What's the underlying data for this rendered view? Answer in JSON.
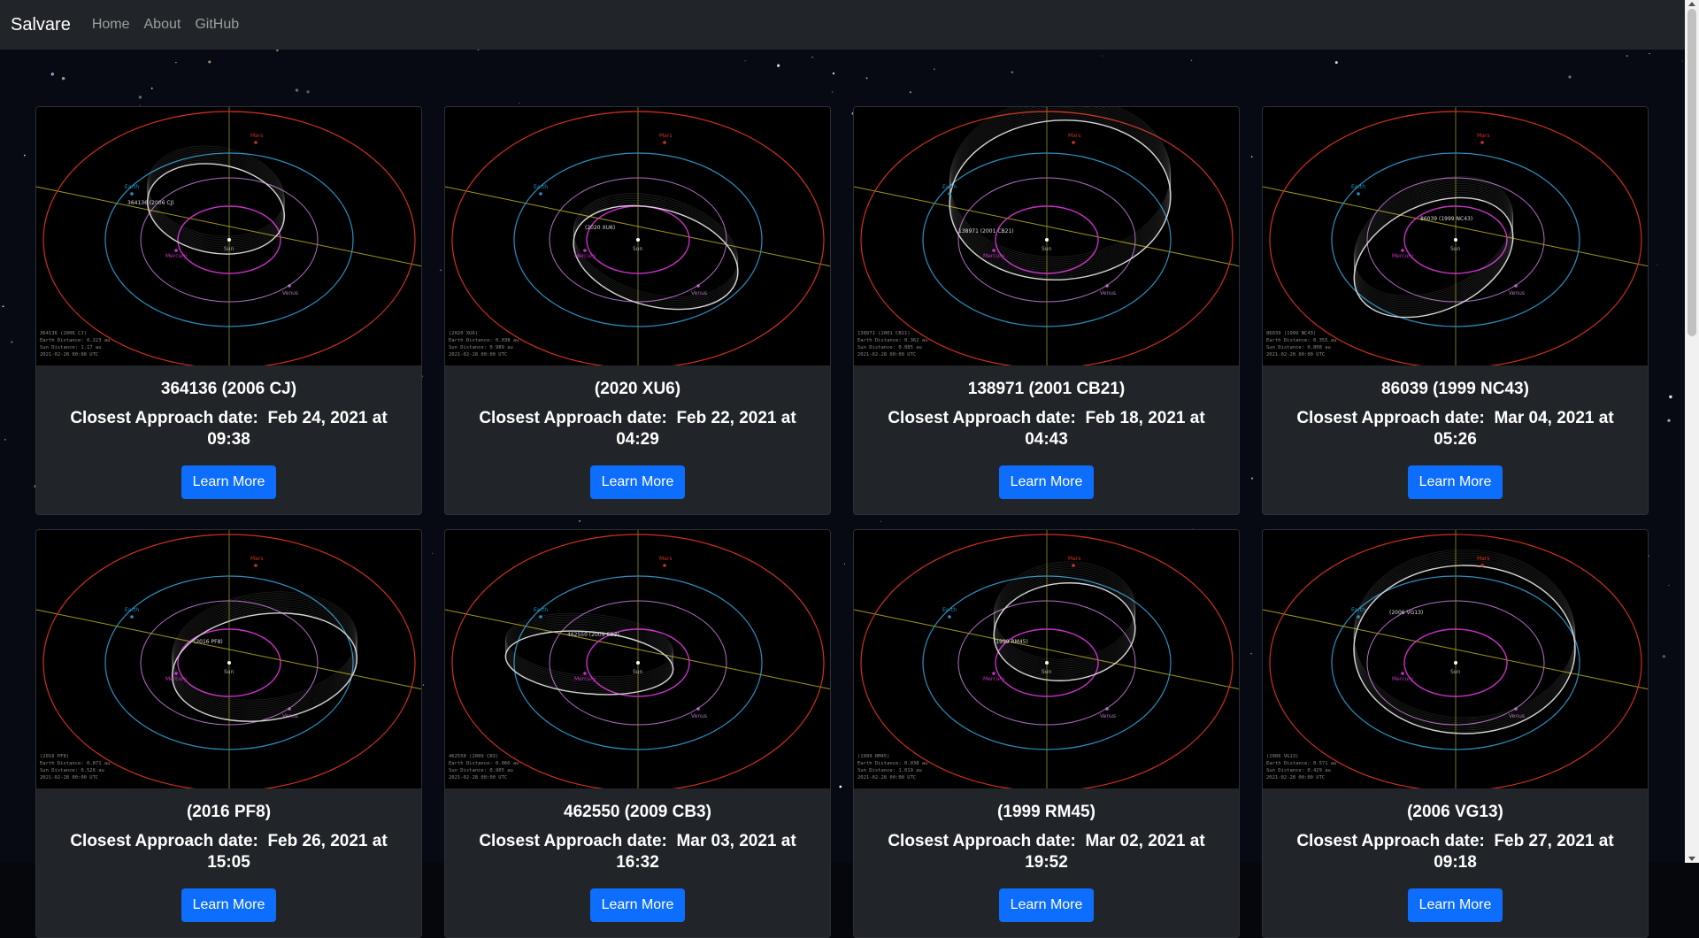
{
  "nav": {
    "brand": "Salvare",
    "links": [
      "Home",
      "About",
      "GitHub"
    ]
  },
  "cards": [
    {
      "name": "364136 (2006 CJ)",
      "approach_label": "Closest Approach date:",
      "approach": "Feb 24, 2021 at 09:38",
      "button": "Learn More"
    },
    {
      "name": "(2020 XU6)",
      "approach_label": "Closest Approach date:",
      "approach": "Feb 22, 2021 at 04:29",
      "button": "Learn More"
    },
    {
      "name": "138971 (2001 CB21)",
      "approach_label": "Closest Approach date:",
      "approach": "Feb 18, 2021 at 04:43",
      "button": "Learn More"
    },
    {
      "name": "86039 (1999 NC43)",
      "approach_label": "Closest Approach date:",
      "approach": "Mar 04, 2021 at 05:26",
      "button": "Learn More"
    },
    {
      "name": "(2016 PF8)",
      "approach_label": "Closest Approach date:",
      "approach": "Feb 26, 2021 at 15:05",
      "button": "Learn More"
    },
    {
      "name": "462550 (2009 CB3)",
      "approach_label": "Closest Approach date:",
      "approach": "Mar 03, 2021 at 16:32",
      "button": "Learn More"
    },
    {
      "name": "(1999 RM45)",
      "approach_label": "Closest Approach date:",
      "approach": "Mar 02, 2021 at 19:52",
      "button": "Learn More"
    },
    {
      "name": "(2006 VG13)",
      "approach_label": "Closest Approach date:",
      "approach": "Feb 27, 2021 at 09:18",
      "button": "Learn More"
    }
  ],
  "orbit_labels": {
    "sun": "Sun",
    "mercury": "Mercury",
    "venus": "Venus",
    "earth": "Earth",
    "mars": "Mars"
  },
  "orbit_info": [
    {
      "line1": "364136 (2006 CJ)",
      "line2": "Earth Distance: 0.223 au",
      "line3": "Sun Distance: 1.17 au",
      "line4": "2021-02-28 00:00 UTC"
    },
    {
      "line1": "(2020 XU6)",
      "line2": "Earth Distance: 0.038 au",
      "line3": "Sun Distance: 0.989 au",
      "line4": "2021-02-28 00:00 UTC"
    },
    {
      "line1": "138971 (2001 CB21)",
      "line2": "Earth Distance: 0.362 au",
      "line3": "Sun Distance: 0.885 au",
      "line4": "2021-02-28 00:00 UTC"
    },
    {
      "line1": "86039 (1999 NC43)",
      "line2": "Earth Distance: 0.355 au",
      "line3": "Sun Distance: 0.808 au",
      "line4": "2021-02-28 00:00 UTC"
    },
    {
      "line1": "(2016 PF8)",
      "line2": "Earth Distance: 0.871 au",
      "line3": "Sun Distance: 0.526 au",
      "line4": "2021-02-28 00:00 UTC"
    },
    {
      "line1": "462550 (2009 CB3)",
      "line2": "Earth Distance: 0.066 au",
      "line3": "Sun Distance: 0.905 au",
      "line4": "2021-02-28 00:00 UTC"
    },
    {
      "line1": "(1999 RM45)",
      "line2": "Earth Distance: 0.038 au",
      "line3": "Sun Distance: 1.019 au",
      "line4": "2021-02-28 00:00 UTC"
    },
    {
      "line1": "(2006 VG13)",
      "line2": "Earth Distance: 0.571 au",
      "line3": "Sun Distance: 0.429 au",
      "line4": "2021-02-28 00:00 UTC"
    }
  ],
  "colors": {
    "navbar": "#212529",
    "card": "#212529",
    "button": "#0d6efd",
    "mercury_orbit": "#c830c8",
    "venus_orbit": "#b070c0",
    "earth_orbit": "#2a8fbf",
    "mars_orbit": "#d03020",
    "ecliptic": "#c8c020",
    "asteroid_orbit": "#d8d8d8"
  }
}
